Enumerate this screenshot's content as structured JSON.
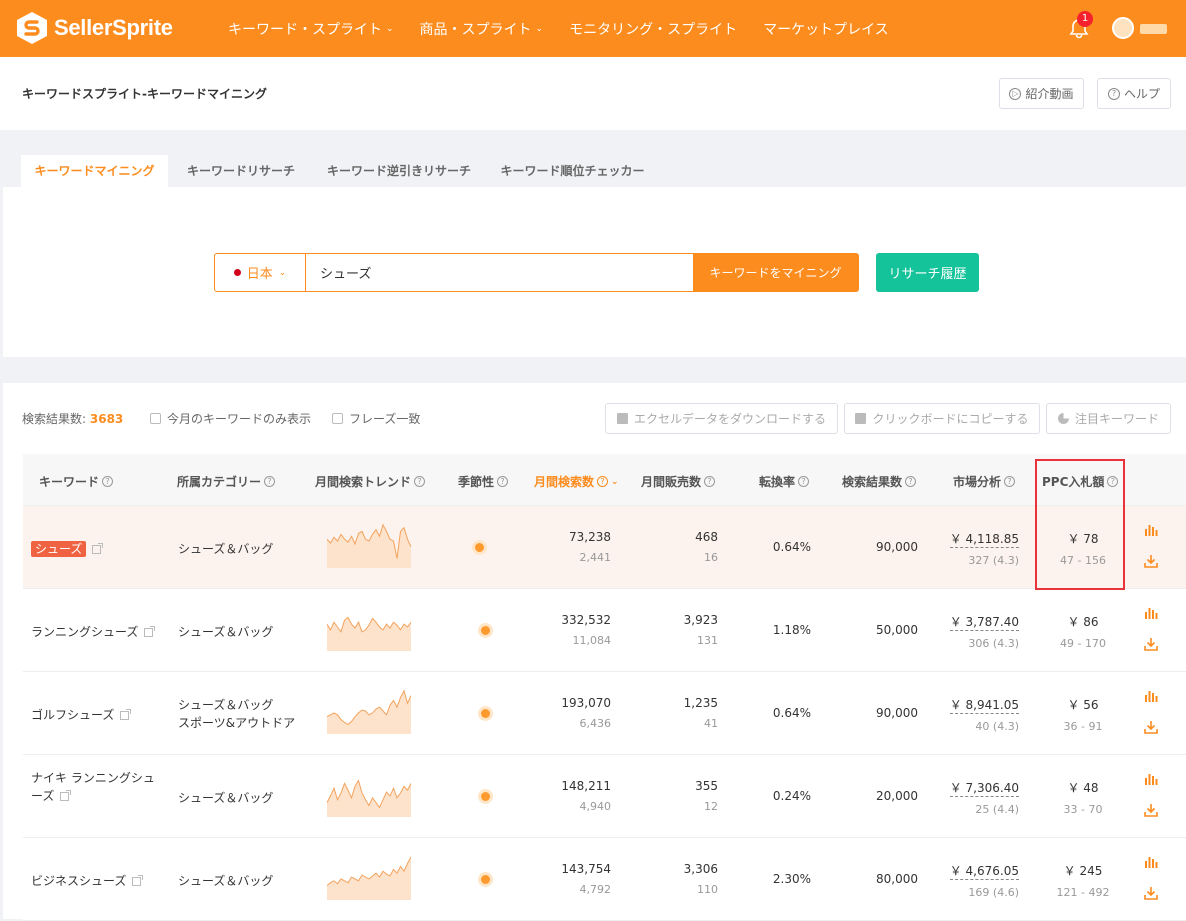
{
  "topbar": {
    "brand": "SellerSprite",
    "nav": [
      {
        "label": "キーワード・スプライト",
        "dropdown": true
      },
      {
        "label": "商品・スプライト",
        "dropdown": true
      },
      {
        "label": "モニタリング・スプライト",
        "dropdown": false
      },
      {
        "label": "マーケットプレイス",
        "dropdown": false
      }
    ],
    "notification_count": "1",
    "caret": "⌄"
  },
  "header": {
    "title": "キーワードスプライト-キーワードマイニング",
    "video_button": "紹介動画",
    "help_button": "ヘルプ",
    "video_icon": "▷",
    "help_icon": "?"
  },
  "tabs": [
    "キーワードマイニング",
    "キーワードリサーチ",
    "キーワード逆引きリサーチ",
    "キーワード順位チェッカー"
  ],
  "search": {
    "country": "日本",
    "country_caret": "⌄",
    "query": "シューズ",
    "submit": "キーワードをマイニング",
    "history": "リサーチ履歴"
  },
  "results": {
    "count_label": "検索結果数:",
    "count": "3683",
    "filter_month": "今月のキーワードのみ表示",
    "filter_phrase": "フレーズ一致",
    "download_btn": "エクセルデータをダウンロードする",
    "copy_btn": "クリックボードにコピーする",
    "watch_btn": "注目キーワード"
  },
  "table": {
    "help_icon": "?",
    "sort_icon": "⌄",
    "headers": [
      "キーワード",
      "所属カテゴリー",
      "月間検索トレンド",
      "季節性",
      "月間検索数",
      "月間販売数",
      "転換率",
      "検索結果数",
      "市場分析",
      "PPC入札額"
    ],
    "rows": [
      {
        "keyword": "シューズ",
        "category": [
          "シューズ＆バッグ"
        ],
        "searches": "73,238",
        "searches_sub": "2,441",
        "sales": "468",
        "sales_sub": "16",
        "conversion": "0.64%",
        "results": "90,000",
        "price": "￥ 4,118.85",
        "reviews": "327 (4.3)",
        "ppc": "￥ 78",
        "ppc_range": "47 - 156",
        "trend": [
          30,
          26,
          32,
          28,
          35,
          30,
          27,
          33,
          25,
          36,
          38,
          30,
          28,
          35,
          40,
          33,
          45,
          38,
          30,
          28,
          10,
          38,
          42,
          30,
          22
        ]
      },
      {
        "keyword": "ランニングシューズ",
        "category": [
          "シューズ＆バッグ"
        ],
        "searches": "332,532",
        "searches_sub": "11,084",
        "sales": "3,923",
        "sales_sub": "131",
        "conversion": "1.18%",
        "results": "50,000",
        "price": "￥ 3,787.40",
        "reviews": "306 (4.3)",
        "ppc": "￥ 86",
        "ppc_range": "49 - 170",
        "trend": [
          28,
          22,
          30,
          25,
          20,
          32,
          35,
          28,
          24,
          30,
          20,
          22,
          27,
          34,
          30,
          25,
          22,
          28,
          24,
          30,
          27,
          22,
          28,
          25,
          30
        ]
      },
      {
        "keyword": "ゴルフシューズ",
        "category": [
          "シューズ＆バッグ",
          "スポーツ&アウトドア"
        ],
        "searches": "193,070",
        "searches_sub": "6,436",
        "sales": "1,235",
        "sales_sub": "41",
        "conversion": "0.64%",
        "results": "90,000",
        "price": "￥ 8,941.05",
        "reviews": "40 (4.3)",
        "ppc": "￥ 56",
        "ppc_range": "36 - 91",
        "trend": [
          18,
          20,
          22,
          20,
          15,
          12,
          10,
          13,
          18,
          22,
          25,
          24,
          20,
          22,
          26,
          28,
          24,
          20,
          30,
          35,
          28,
          38,
          45,
          32,
          40
        ]
      },
      {
        "keyword": "ナイキ ランニングシューズ",
        "category": [
          "シューズ＆バッグ"
        ],
        "searches": "148,211",
        "searches_sub": "4,940",
        "sales": "355",
        "sales_sub": "12",
        "conversion": "0.24%",
        "results": "20,000",
        "price": "￥ 7,306.40",
        "reviews": "25 (4.4)",
        "ppc": "￥ 48",
        "ppc_range": "33 - 70",
        "trend": [
          15,
          22,
          30,
          18,
          25,
          35,
          28,
          20,
          32,
          38,
          25,
          18,
          12,
          20,
          15,
          10,
          18,
          26,
          22,
          30,
          20,
          25,
          32,
          28,
          35
        ]
      },
      {
        "keyword": "ビジネスシューズ",
        "category": [
          "シューズ＆バッグ"
        ],
        "searches": "143,754",
        "searches_sub": "4,792",
        "sales": "3,306",
        "sales_sub": "110",
        "conversion": "2.30%",
        "results": "80,000",
        "price": "￥ 4,676.05",
        "reviews": "169 (4.6)",
        "ppc": "￥ 245",
        "ppc_range": "121 - 492",
        "trend": [
          15,
          18,
          20,
          17,
          22,
          20,
          18,
          24,
          22,
          20,
          26,
          24,
          22,
          25,
          28,
          24,
          30,
          27,
          25,
          32,
          28,
          35,
          30,
          38,
          45
        ]
      }
    ]
  }
}
